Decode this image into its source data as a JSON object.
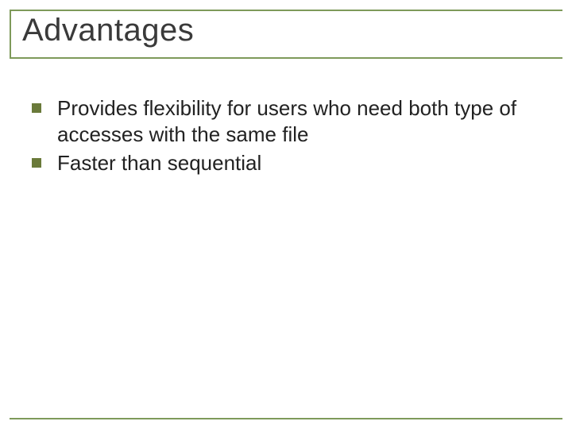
{
  "title": "Advantages",
  "bullets": [
    "Provides flexibility for users who need both type of accesses with the same file",
    "Faster than sequential"
  ],
  "colors": {
    "accent": "#7e9a5a",
    "bullet": "#6a7a3a",
    "text": "#222222",
    "title": "#3a3a3a"
  }
}
